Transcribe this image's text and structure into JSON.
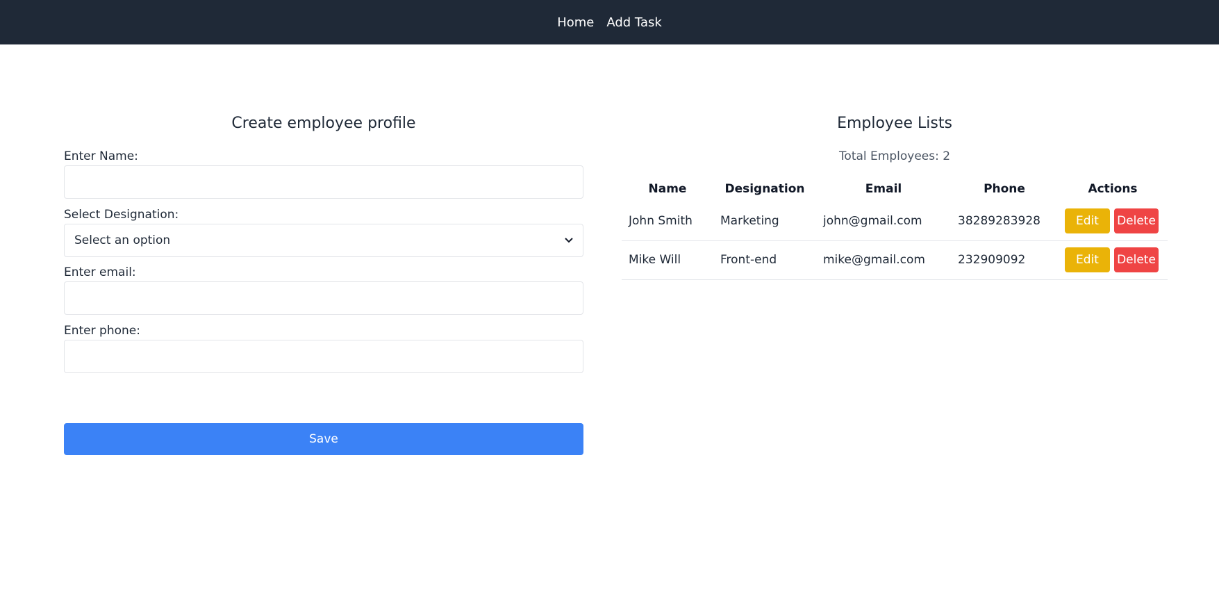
{
  "nav": {
    "items": [
      {
        "label": "Home"
      },
      {
        "label": "Add Task"
      }
    ]
  },
  "form": {
    "title": "Create employee profile",
    "name_label": "Enter Name:",
    "name_value": "",
    "designation_label": "Select Designation:",
    "designation_selected": "Select an option",
    "email_label": "Enter email:",
    "email_value": "",
    "phone_label": "Enter phone:",
    "phone_value": "",
    "save_label": "Save"
  },
  "list": {
    "title": "Employee Lists",
    "total_text": "Total Employees: 2",
    "columns": [
      "Name",
      "Designation",
      "Email",
      "Phone",
      "Actions"
    ],
    "rows": [
      {
        "name": "John Smith",
        "designation": "Marketing",
        "email": "john@gmail.com",
        "phone": "38289283928",
        "edit_label": "Edit",
        "delete_label": "Delete"
      },
      {
        "name": "Mike Will",
        "designation": "Front-end",
        "email": "mike@gmail.com",
        "phone": "232909092",
        "edit_label": "Edit",
        "delete_label": "Delete"
      }
    ]
  },
  "colors": {
    "navbar": "#1f2937",
    "primary": "#3b82f6",
    "edit": "#eab308",
    "delete": "#ef4444"
  },
  "icons": {
    "select_chevron": "chevron-down-icon"
  }
}
